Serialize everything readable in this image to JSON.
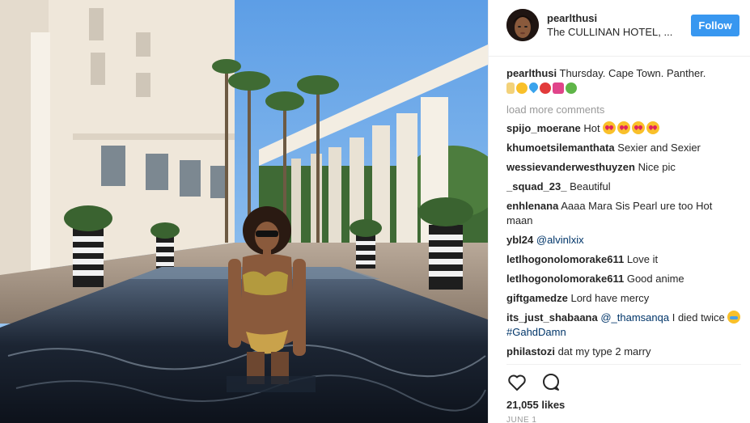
{
  "post": {
    "username": "pearlthusi",
    "location": "The CULLINAN HOTEL, ...",
    "follow_label": "Follow",
    "caption": {
      "author": "pearlthusi",
      "text": "Thursday. Cape Town. Panther."
    },
    "load_more_label": "load more comments",
    "comments": [
      {
        "user": "spijo_moerane",
        "text": "Hot",
        "hearts": 4
      },
      {
        "user": "khumoetsilemanthata",
        "text": "Sexier and Sexier"
      },
      {
        "user": "wessievanderwesthuyzen",
        "text": "Nice pic"
      },
      {
        "user": "_squad_23_",
        "text": "Beautiful"
      },
      {
        "user": "enhlenana",
        "text": "Aaaa Mara Sis Pearl ure too Hot maan"
      },
      {
        "user": "ybl24",
        "mention": "@alvinlxix"
      },
      {
        "user": "letlhogonolomorake611",
        "text": "Love it"
      },
      {
        "user": "letlhogonolomorake611",
        "text": "Good anime"
      },
      {
        "user": "giftgamedze",
        "text": "Lord have mercy"
      },
      {
        "user": "its_just_shabaana",
        "mention": "@_thamsanqa",
        "text": "I died twice",
        "hashtag": "#GahdDamn"
      },
      {
        "user": "philastozi",
        "text": "dat my type 2 marry"
      }
    ],
    "likes": "21,055 likes",
    "date": "JUNE 1"
  },
  "icons": {
    "like": "heart-outline-icon",
    "comment": "speech-bubble-icon"
  },
  "colors": {
    "follow_button": "#3897f0",
    "muted_text": "#999999",
    "mention": "#003569"
  }
}
